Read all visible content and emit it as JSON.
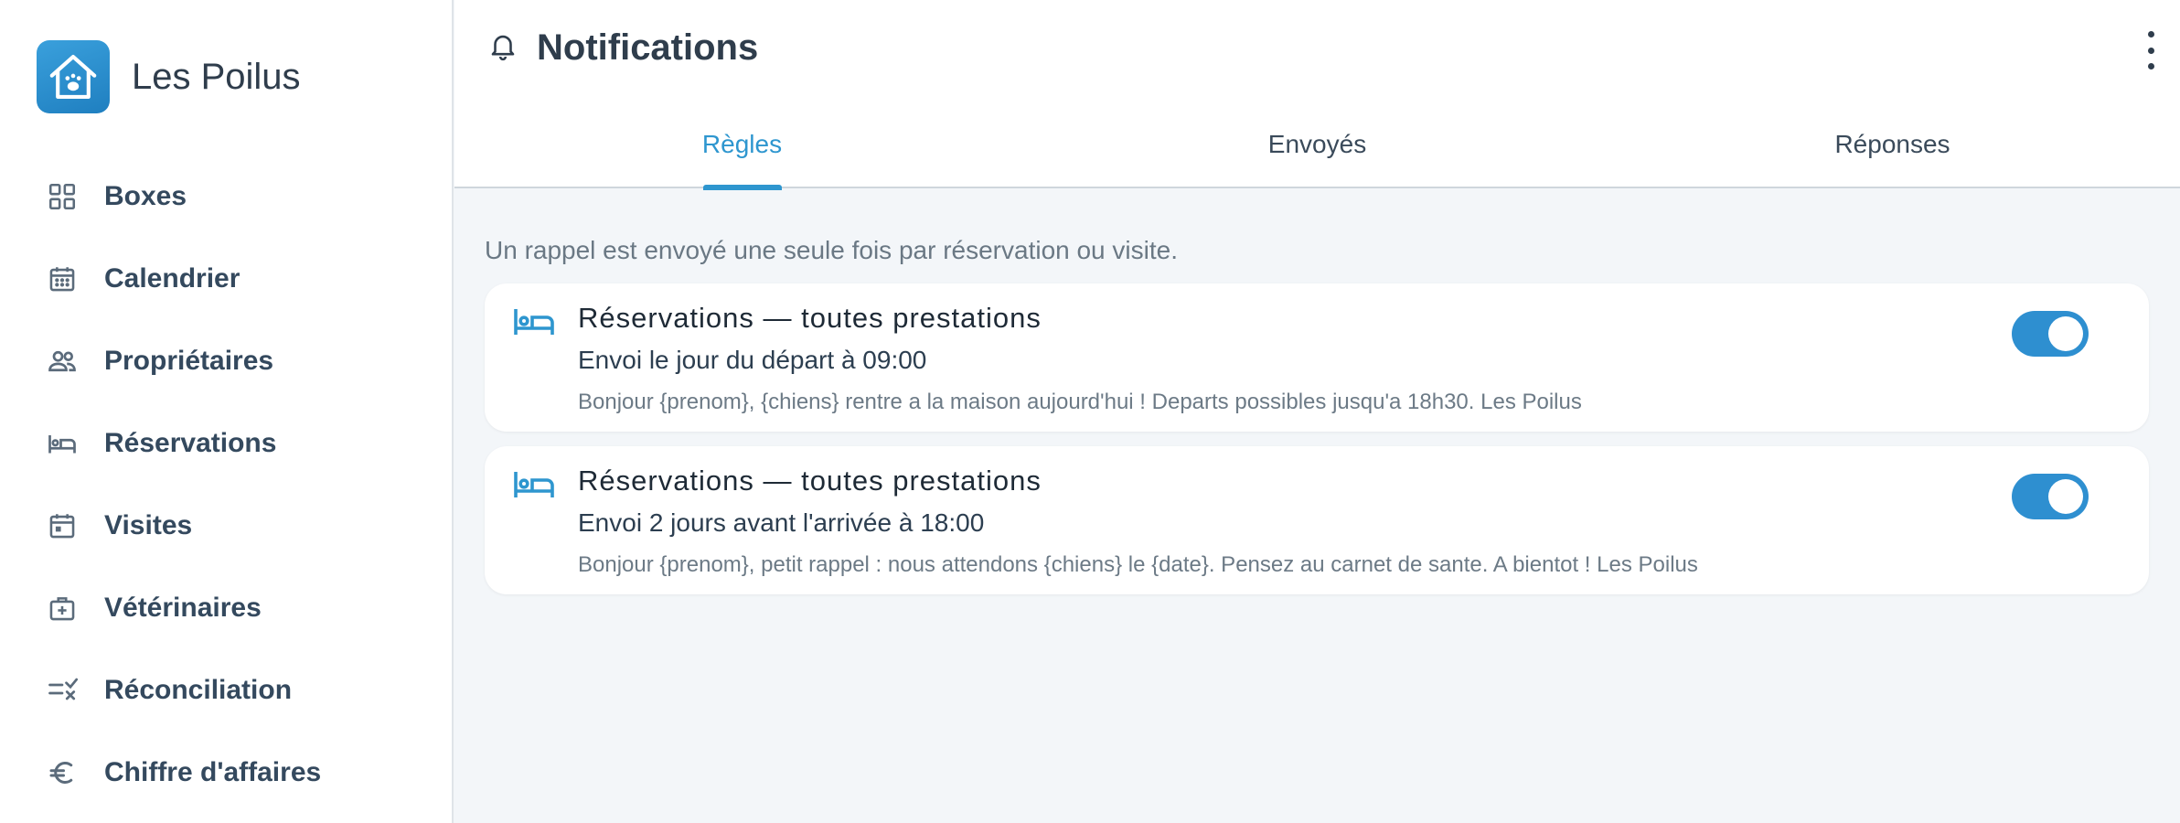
{
  "brand": {
    "name": "Les Poilus",
    "logo_icon": "house-paw-icon",
    "accent": "#2e96cf"
  },
  "sidebar": {
    "items": [
      {
        "label": "Boxes",
        "icon": "grid-icon"
      },
      {
        "label": "Calendrier",
        "icon": "calendar-icon"
      },
      {
        "label": "Propriétaires",
        "icon": "people-icon"
      },
      {
        "label": "Réservations",
        "icon": "bed-icon"
      },
      {
        "label": "Visites",
        "icon": "calendar-day-icon"
      },
      {
        "label": "Vétérinaires",
        "icon": "medical-bag-icon"
      },
      {
        "label": "Réconciliation",
        "icon": "list-check-icon"
      },
      {
        "label": "Chiffre d'affaires",
        "icon": "euro-icon"
      }
    ]
  },
  "header": {
    "title": "Notifications",
    "icon": "bell-icon",
    "menu_icon": "more-vertical-icon"
  },
  "tabs": [
    {
      "label": "Règles",
      "active": true
    },
    {
      "label": "Envoyés",
      "active": false
    },
    {
      "label": "Réponses",
      "active": false
    }
  ],
  "main": {
    "hint": "Un rappel est envoyé une seule fois par réservation ou visite.",
    "rules": [
      {
        "title": "Réservations — toutes prestations",
        "schedule": "Envoi le jour du départ à 09:00",
        "message": "Bonjour {prenom}, {chiens} rentre a la maison aujourd'hui ! Departs possibles jusqu'a 18h30. Les Poilus",
        "enabled": true,
        "icon": "bed-icon"
      },
      {
        "title": "Réservations — toutes prestations",
        "schedule": "Envoi 2 jours avant l'arrivée à 18:00",
        "message": "Bonjour {prenom}, petit rappel : nous attendons {chiens} le {date}. Pensez au carnet de sante. A bientot ! Les Poilus",
        "enabled": true,
        "icon": "bed-icon"
      }
    ]
  }
}
